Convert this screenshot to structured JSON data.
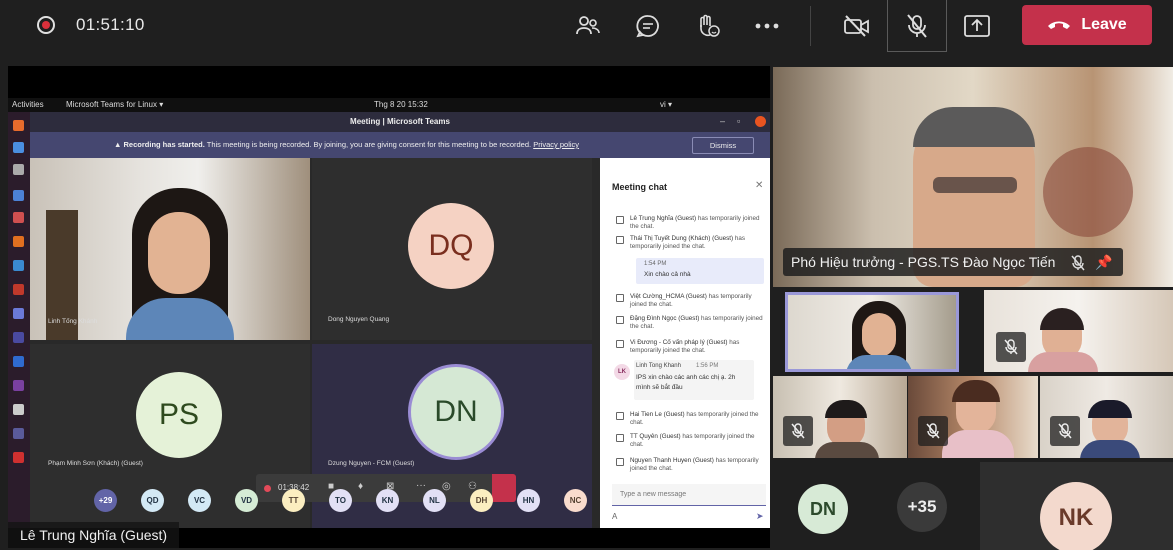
{
  "meeting": {
    "timer": "01:51:10",
    "leave_label": "Leave",
    "colors": {
      "leave": "#c4314b",
      "accent": "#6264a7"
    }
  },
  "toolbar_icons": [
    "record-icon",
    "participants-icon",
    "chat-icon",
    "raise-hand-icon",
    "more-icon",
    "camera-off-icon",
    "mic-off-icon",
    "share-icon",
    "hangup-icon"
  ],
  "shared_screen": {
    "os_bar": {
      "activities": "Activities",
      "app": "Microsoft Teams for Linux ▾",
      "clock": "Thg 8 20  15:32",
      "lang": "vi ▾"
    },
    "window_title": "Meeting | Microsoft Teams",
    "banner": {
      "bold": "Recording has started.",
      "text": " This meeting is being recorded. By joining, you are giving consent for this meeting to be recorded.",
      "link": "Privacy policy",
      "dismiss": "Dismiss"
    },
    "tiles": [
      {
        "name": "Linh Tống Khánh"
      },
      {
        "initials": "DQ",
        "name": "Dong Nguyen Quang"
      },
      {
        "initials": "PS",
        "name": "Phạm Minh Sơn (Khách) (Guest)"
      },
      {
        "initials": "DN",
        "name": "Dzung Nguyen - FCM (Guest)"
      }
    ],
    "inner_timer": "01:38:42",
    "mini_avatars": [
      "+29",
      "QD",
      "VC",
      "VD",
      "TT",
      "TO",
      "KN",
      "NL",
      "DH",
      "HN",
      "NC"
    ],
    "chat": {
      "title": "Meeting chat",
      "items": [
        {
          "who": "Lê Trung Nghĩa (Guest)",
          "text": " has temporarily joined the chat."
        },
        {
          "who": "Thái Thị Tuyết Dung (Khách) (Guest)",
          "text": " has temporarily joined the chat."
        },
        {
          "who": "Việt Cường_HCMA (Guest)",
          "text": " has temporarily joined the chat."
        },
        {
          "who": "Đặng Đình Ngọc (Guest)",
          "text": " has temporarily joined the chat."
        },
        {
          "who": "Vi Đương - Cố vấn pháp lý (Guest)",
          "text": " has temporarily joined the chat."
        },
        {
          "who": "Hai Tien Le (Guest)",
          "text": " has temporarily joined the chat."
        },
        {
          "who": "TT Quyên (Guest)",
          "text": " has temporarily joined the chat."
        },
        {
          "who": "Nguyen Thanh Huyen (Guest)",
          "text": " has temporarily joined the chat."
        }
      ],
      "msg1": {
        "time": "1:54 PM",
        "text": "Xin chào cả nhà"
      },
      "msg2": {
        "initials": "LK",
        "sender": "Linh Tong Khanh",
        "time": "1:56 PM",
        "text": "IPS xin chào các anh các chị ạ. 2h mình sẽ bắt đầu"
      },
      "input_placeholder": "Type a new message"
    }
  },
  "presenter_name": "Lê Trung Nghĩa (Guest)",
  "speaker": {
    "name": "Phó Hiệu trưởng - PGS.TS Đào Ngọc Tiến"
  },
  "bottom_avatars": {
    "dn": "DN",
    "more": "+35",
    "nk": "NK"
  }
}
